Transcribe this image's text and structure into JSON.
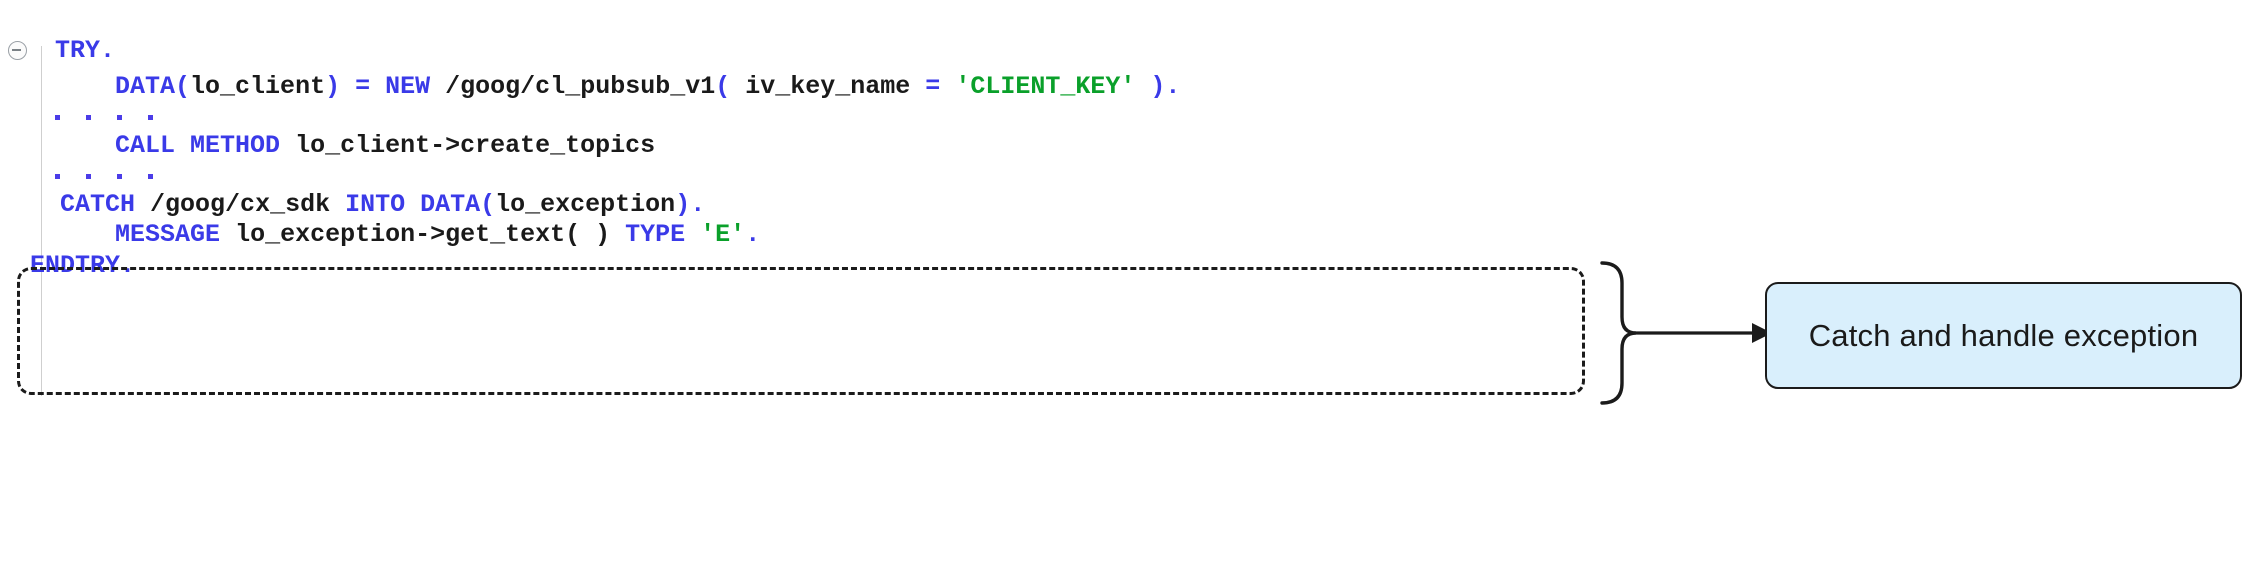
{
  "editor": {
    "language": "ABAP",
    "fold_toggle_icon": "collapse-minus-circle-icon",
    "continuation_marker": ". . . .",
    "lines": [
      {
        "id": "line-try",
        "indent": 0,
        "tokens": [
          {
            "text": "TRY",
            "type": "kw"
          },
          {
            "text": ".",
            "type": "op"
          }
        ]
      },
      {
        "id": "line-data-client",
        "indent": 1,
        "tokens": [
          {
            "text": "DATA",
            "type": "kw"
          },
          {
            "text": "(",
            "type": "op"
          },
          {
            "text": "lo_client",
            "type": "id"
          },
          {
            "text": ")",
            "type": "op"
          },
          {
            "text": " ",
            "type": "id"
          },
          {
            "text": "=",
            "type": "op"
          },
          {
            "text": " ",
            "type": "id"
          },
          {
            "text": "NEW",
            "type": "kw"
          },
          {
            "text": " ",
            "type": "id"
          },
          {
            "text": "/goog/cl_pubsub_v1",
            "type": "id"
          },
          {
            "text": "(",
            "type": "op"
          },
          {
            "text": " iv_key_name ",
            "type": "id"
          },
          {
            "text": "=",
            "type": "op"
          },
          {
            "text": " ",
            "type": "id"
          },
          {
            "text": "'CLIENT_KEY'",
            "type": "str"
          },
          {
            "text": " ",
            "type": "id"
          },
          {
            "text": ")",
            "type": "op"
          },
          {
            "text": ".",
            "type": "op"
          }
        ]
      },
      {
        "id": "line-call-method",
        "indent": 1,
        "tokens": [
          {
            "text": "CALL",
            "type": "kw"
          },
          {
            "text": " ",
            "type": "id"
          },
          {
            "text": "METHOD",
            "type": "kw"
          },
          {
            "text": " ",
            "type": "id"
          },
          {
            "text": "lo_client->create_topics",
            "type": "id"
          }
        ]
      },
      {
        "id": "line-catch",
        "indent": 0,
        "tokens": [
          {
            "text": "  ",
            "type": "id"
          },
          {
            "text": "CATCH",
            "type": "kw"
          },
          {
            "text": " ",
            "type": "id"
          },
          {
            "text": "/goog/cx_sdk",
            "type": "id"
          },
          {
            "text": " ",
            "type": "id"
          },
          {
            "text": "INTO",
            "type": "kw"
          },
          {
            "text": " ",
            "type": "id"
          },
          {
            "text": "DATA",
            "type": "kw"
          },
          {
            "text": "(",
            "type": "op"
          },
          {
            "text": "lo_exception",
            "type": "id"
          },
          {
            "text": ")",
            "type": "op"
          },
          {
            "text": ".",
            "type": "op"
          }
        ]
      },
      {
        "id": "line-message",
        "indent": 1,
        "tokens": [
          {
            "text": "MESSAGE",
            "type": "kw"
          },
          {
            "text": " ",
            "type": "id"
          },
          {
            "text": "lo_exception->get_text( )",
            "type": "id"
          },
          {
            "text": " ",
            "type": "id"
          },
          {
            "text": "TYPE",
            "type": "kw"
          },
          {
            "text": " ",
            "type": "id"
          },
          {
            "text": "'E'",
            "type": "str"
          },
          {
            "text": ".",
            "type": "op"
          }
        ]
      },
      {
        "id": "line-endtry",
        "indent": 0,
        "tokens": [
          {
            "text": "ENDTRY",
            "type": "kw"
          },
          {
            "text": ".",
            "type": "op"
          }
        ]
      }
    ]
  },
  "annotation": {
    "callout_label": "Catch and handle exception",
    "brace_icon": "right-curly-brace-icon",
    "arrow_icon": "arrow-right-icon",
    "highlight_style": "dashed-rounded-rectangle"
  },
  "colors": {
    "keyword": "#3a3ae8",
    "identifier": "#1a1a1a",
    "string": "#0aa02a",
    "callout_fill": "#d9effc",
    "callout_border": "#1b1b1b",
    "highlight_border": "#1b1b1b",
    "background": "#ffffff",
    "fold_guide": "#cfcfcf"
  }
}
